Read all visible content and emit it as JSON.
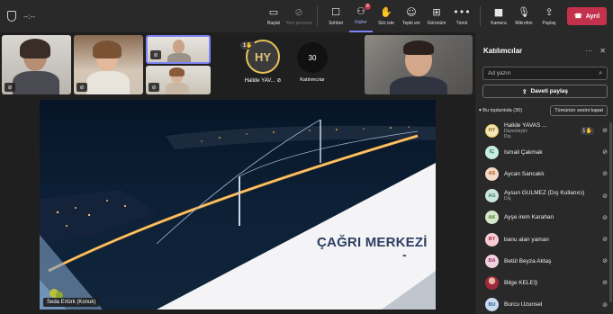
{
  "meeting": {
    "timer": "--:--"
  },
  "toolbar": {
    "buttons": [
      {
        "label": "Başlat",
        "icon": "present-icon"
      },
      {
        "label": "Yeni pencere",
        "icon": "new-window-icon"
      },
      {
        "label": "Sohbet",
        "icon": "chat-icon"
      },
      {
        "label": "Kişiler",
        "icon": "people-icon",
        "badge": "8"
      },
      {
        "label": "Söz iste",
        "icon": "raise-hand-icon"
      },
      {
        "label": "Tepki ver",
        "icon": "reaction-icon"
      },
      {
        "label": "Görünüm",
        "icon": "view-icon"
      },
      {
        "label": "Tümü",
        "icon": "more-icon"
      },
      {
        "label": "Kamera",
        "icon": "camera-icon"
      },
      {
        "label": "Mikrofon",
        "icon": "mic-off-icon"
      },
      {
        "label": "Paylaş",
        "icon": "share-icon"
      }
    ],
    "leave_label": "Ayrıl"
  },
  "stage": {
    "hy_initials": "HY",
    "hy_hand_count": "1",
    "hy_name": "Halide YAV...",
    "participant_count": "30",
    "participant_label": "Katılımcılar",
    "share_owner": "Seda Ertürk (Konuk)",
    "slide_title": "ÇAĞRI MERKEZİ",
    "slide_dash": "-"
  },
  "panel": {
    "title": "Katılımcılar",
    "search_placeholder": "Ad yazın",
    "share_invite": "Daveti paylaş",
    "section_label": "Bu toplantıda (30)",
    "mute_all": "Tümünün sesini kapat",
    "participants": [
      {
        "initials": "HY",
        "name": "Halide YAVAS ...",
        "role": "Düzenleyici",
        "sub": "Dış",
        "hand": "1",
        "color": "#e8c35c",
        "bg": "#f3e6b9"
      },
      {
        "initials": "İÇ",
        "name": "İsmail Çakmak",
        "color": "#3a8f7e",
        "bg": "#c9ece3"
      },
      {
        "initials": "AS",
        "name": "Aycan Sancaklı",
        "color": "#b3571e",
        "bg": "#f6d9c5"
      },
      {
        "initials": "AG",
        "name": "Aysun GULMEZ (Dış Kullanıcı)",
        "sub": "Dış",
        "color": "#3e7b6c",
        "bg": "#cbe7df"
      },
      {
        "initials": "AK",
        "name": "Ayşe irem Karahan",
        "color": "#4f7a30",
        "bg": "#d6e8c7"
      },
      {
        "initials": "BY",
        "name": "banu alan yaman",
        "color": "#b0304a",
        "bg": "#f5cdd4"
      },
      {
        "initials": "BA",
        "name": "Betül Beyza Aktaş",
        "color": "#9a3a6a",
        "bg": "#f1d0e1"
      },
      {
        "initials": "",
        "name": "Bilge KELEŞ",
        "color": "#ffffff",
        "bg": "#9c2a3a",
        "photo": true
      },
      {
        "initials": "BU",
        "name": "Burcu Uzunsel",
        "color": "#2f5f95",
        "bg": "#cadbf0"
      }
    ]
  }
}
